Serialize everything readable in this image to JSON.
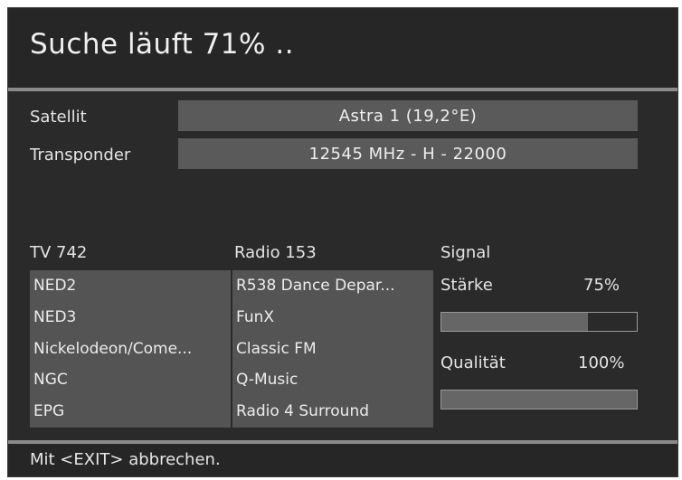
{
  "header": {
    "title": "Suche läuft  71% .."
  },
  "satellite": {
    "label": "Satellit",
    "value": "Astra 1 (19,2°E)"
  },
  "transponder": {
    "label": "Transponder",
    "value": "12545 MHz - H - 22000"
  },
  "tv": {
    "header": "TV  742",
    "items": [
      "NED2",
      "NED3",
      "Nickelodeon/Come...",
      "NGC",
      "EPG"
    ]
  },
  "radio": {
    "header": "Radio  153",
    "items": [
      "R538 Dance Depar...",
      "FunX",
      "Classic FM",
      "Q-Music",
      "Radio 4 Surround"
    ]
  },
  "signal": {
    "header": "Signal",
    "strength_label": "Stärke",
    "strength_value": "75%",
    "strength_fraction": 0.75,
    "quality_label": "Qualität",
    "quality_value": "100%",
    "quality_fraction": 1.0
  },
  "footer": {
    "hint": "Mit <EXIT> abbrechen."
  },
  "colors": {
    "background": "#2a2a2a",
    "field": "#5a5a5a",
    "separator": "#8a8a8a"
  }
}
